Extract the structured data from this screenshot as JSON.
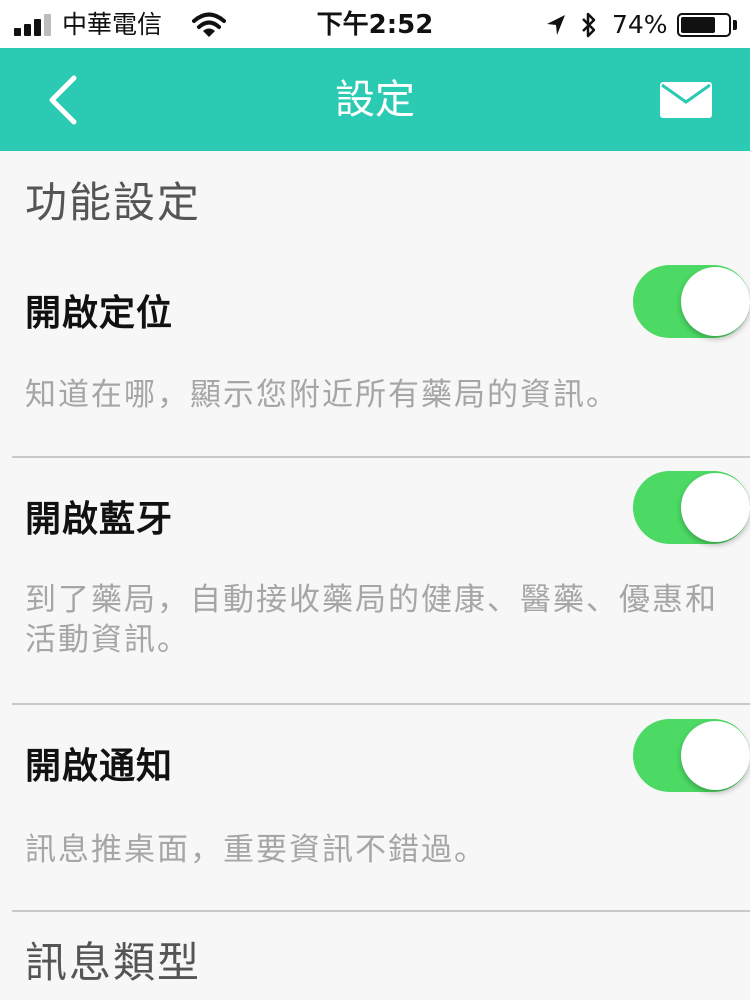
{
  "status_bar": {
    "carrier": "中華電信",
    "time": "下午2:52",
    "battery_percent": "74%",
    "battery_level": 0.74,
    "icons": [
      "signal-icon",
      "wifi-icon",
      "location-arrow-icon",
      "bluetooth-icon",
      "battery-icon"
    ]
  },
  "nav": {
    "title": "設定",
    "back_icon": "chevron-left-icon",
    "mail_icon": "envelope-icon"
  },
  "sections": {
    "function_settings": "功能設定",
    "message_types": "訊息類型"
  },
  "settings": [
    {
      "title": "開啟定位",
      "description": "知道在哪，顯示您附近所有藥局的資訊。",
      "enabled": true
    },
    {
      "title": "開啟藍牙",
      "description": "到了藥局，自動接收藥局的健康、醫藥、優惠和活動資訊。",
      "enabled": true
    },
    {
      "title": "開啟通知",
      "description": "訊息推桌面，重要資訊不錯過。",
      "enabled": true
    }
  ],
  "colors": {
    "nav_background": "#2bcab2",
    "toggle_on": "#4cd964",
    "page_background": "#f7f7f7",
    "description_text": "#a6a6a6"
  }
}
